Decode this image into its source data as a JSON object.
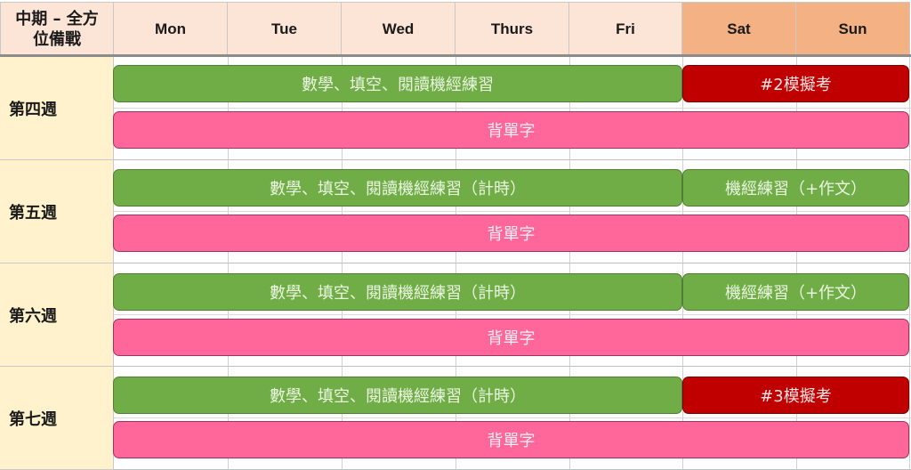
{
  "header": {
    "corner_line1": "中期 – 全方",
    "corner_line2": "位備戰",
    "days": [
      "Mon",
      "Tue",
      "Wed",
      "Thurs",
      "Fri",
      "Sat",
      "Sun"
    ]
  },
  "colors": {
    "weekday_header": "#fce4d6",
    "weekend_header": "#f4b183",
    "week_label_bg": "#fff2cc",
    "practice_bar": "#70ad47",
    "mock_exam_bar": "#c00000",
    "vocab_bar": "#ff6699"
  },
  "weeks": [
    {
      "label": "第四週",
      "weekday_task": "數學、填空、閱讀機經練習",
      "weekend_task": "#2模擬考",
      "weekend_type": "red",
      "daily_task": "背單字"
    },
    {
      "label": "第五週",
      "weekday_task": "數學、填空、閱讀機經練習（計時）",
      "weekend_task": "機經練習（+作文）",
      "weekend_type": "green",
      "daily_task": "背單字"
    },
    {
      "label": "第六週",
      "weekday_task": "數學、填空、閱讀機經練習（計時）",
      "weekend_task": "機經練習（+作文）",
      "weekend_type": "green",
      "daily_task": "背單字"
    },
    {
      "label": "第七週",
      "weekday_task": "數學、填空、閱讀機經練習（計時）",
      "weekend_task": "#3模擬考",
      "weekend_type": "red",
      "daily_task": "背單字"
    }
  ]
}
